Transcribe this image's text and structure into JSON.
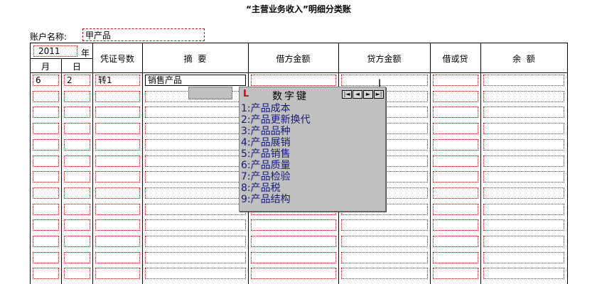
{
  "page": {
    "title": "“主营业务收入”明细分类账"
  },
  "account": {
    "label": "账户名称:",
    "value": "甲产品"
  },
  "ledger": {
    "year": "2011",
    "year_suffix": "年",
    "headers": {
      "month": "月",
      "day": "日",
      "voucher": "凭证号数",
      "summary": "摘  要",
      "debit": "借方金额",
      "credit": "贷方金额",
      "dc": "借或贷",
      "balance": "余  额"
    },
    "first_row": {
      "month": "6",
      "day": "2",
      "voucher": "转1",
      "summary": "销售产品"
    }
  },
  "popup": {
    "title": "数字键",
    "logo": "L",
    "nav_buttons": [
      "|◄",
      "◄",
      "►",
      "►|"
    ],
    "items": [
      "1:产品成本",
      "2:产品更新换代",
      "3:产品品种",
      "4:产品展销",
      "5:产品销售",
      "6:产品质量",
      "7:产品检验",
      "8:产品税",
      "9:产品结构"
    ]
  }
}
